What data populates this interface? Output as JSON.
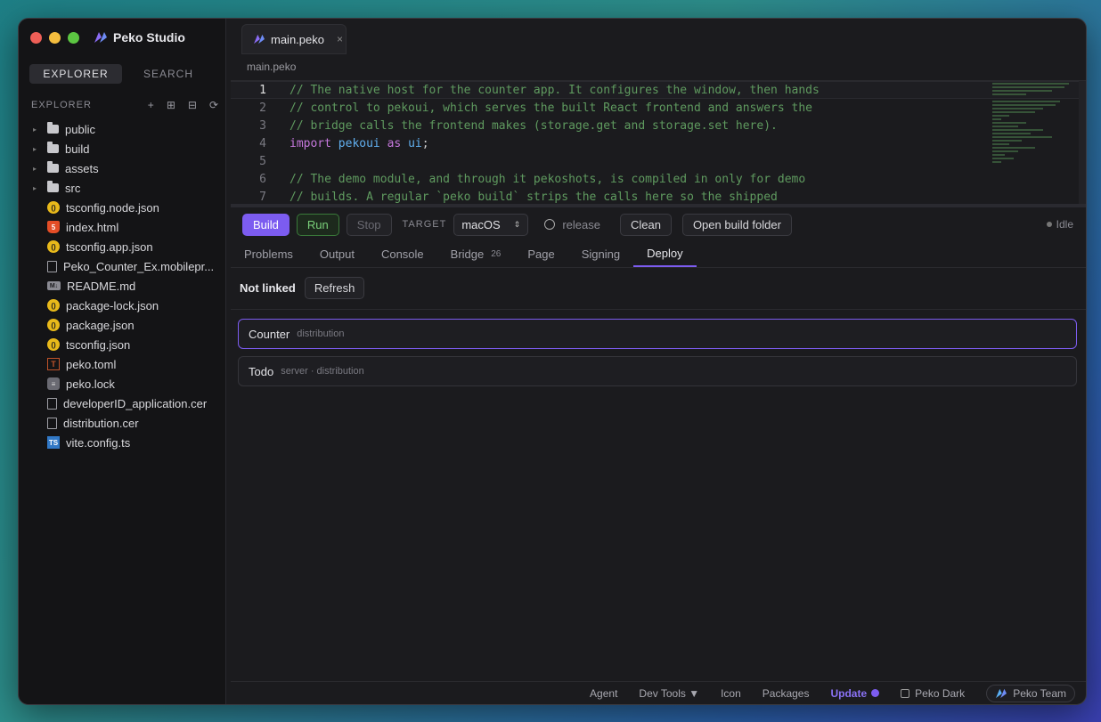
{
  "app": {
    "title": "Peko Studio"
  },
  "sidebar": {
    "tabs": [
      "EXPLORER",
      "SEARCH"
    ],
    "section_title": "EXPLORER",
    "actions": [
      "+",
      "⊞",
      "⊟",
      "⟳"
    ],
    "tree": [
      {
        "name": "public",
        "type": "folder"
      },
      {
        "name": "build",
        "type": "folder"
      },
      {
        "name": "assets",
        "type": "folder"
      },
      {
        "name": "src",
        "type": "folder"
      },
      {
        "name": "tsconfig.node.json",
        "type": "json"
      },
      {
        "name": "index.html",
        "type": "html"
      },
      {
        "name": "tsconfig.app.json",
        "type": "json"
      },
      {
        "name": "Peko_Counter_Ex.mobilepr...",
        "type": "doc"
      },
      {
        "name": "README.md",
        "type": "md"
      },
      {
        "name": "package-lock.json",
        "type": "json"
      },
      {
        "name": "package.json",
        "type": "json"
      },
      {
        "name": "tsconfig.json",
        "type": "json"
      },
      {
        "name": "peko.toml",
        "type": "toml"
      },
      {
        "name": "peko.lock",
        "type": "lock"
      },
      {
        "name": "developerID_application.cer",
        "type": "doc"
      },
      {
        "name": "distribution.cer",
        "type": "doc"
      },
      {
        "name": "vite.config.ts",
        "type": "ts"
      }
    ]
  },
  "editor": {
    "tab": "main.peko",
    "breadcrumb": "main.peko",
    "lines": [
      {
        "n": "1",
        "text": "// The native host for the counter app. It configures the window, then hands"
      },
      {
        "n": "2",
        "text": "// control to pekoui, which serves the built React frontend and answers the"
      },
      {
        "n": "3",
        "text": "// bridge calls the frontend makes (storage.get and storage.set here)."
      },
      {
        "n": "4",
        "kw1": "import",
        "id": "pekoui",
        "kw2": "as",
        "id2": "ui",
        "end": ";"
      },
      {
        "n": "5",
        "text": ""
      },
      {
        "n": "6",
        "text": "// The demo module, and through it pekoshots, is compiled in only for demo"
      },
      {
        "n": "7",
        "text": "// builds. A regular `peko build` strips the calls here so the shipped"
      }
    ]
  },
  "toolbar": {
    "build": "Build",
    "run": "Run",
    "stop": "Stop",
    "target_label": "TARGET",
    "target_value": "macOS",
    "release": "release",
    "clean": "Clean",
    "open_folder": "Open build folder",
    "status": "Idle"
  },
  "panel_tabs": [
    {
      "label": "Problems"
    },
    {
      "label": "Output"
    },
    {
      "label": "Console"
    },
    {
      "label": "Bridge",
      "badge": "26"
    },
    {
      "label": "Page"
    },
    {
      "label": "Signing"
    },
    {
      "label": "Deploy"
    }
  ],
  "deploy": {
    "status": "Not linked",
    "refresh": "Refresh",
    "apps": [
      {
        "name": "Counter",
        "sub": "distribution"
      },
      {
        "name": "Todo",
        "sub": "server · distribution"
      }
    ]
  },
  "statusbar": {
    "agent": "Agent",
    "devtools": "Dev Tools ▼",
    "icon": "Icon",
    "packages": "Packages",
    "update": "Update",
    "theme": "Peko Dark",
    "team": "Peko Team"
  },
  "colors": {
    "accent": "#7c5cf0",
    "run": "#7ad07a",
    "comment": "#5f9a5f"
  }
}
